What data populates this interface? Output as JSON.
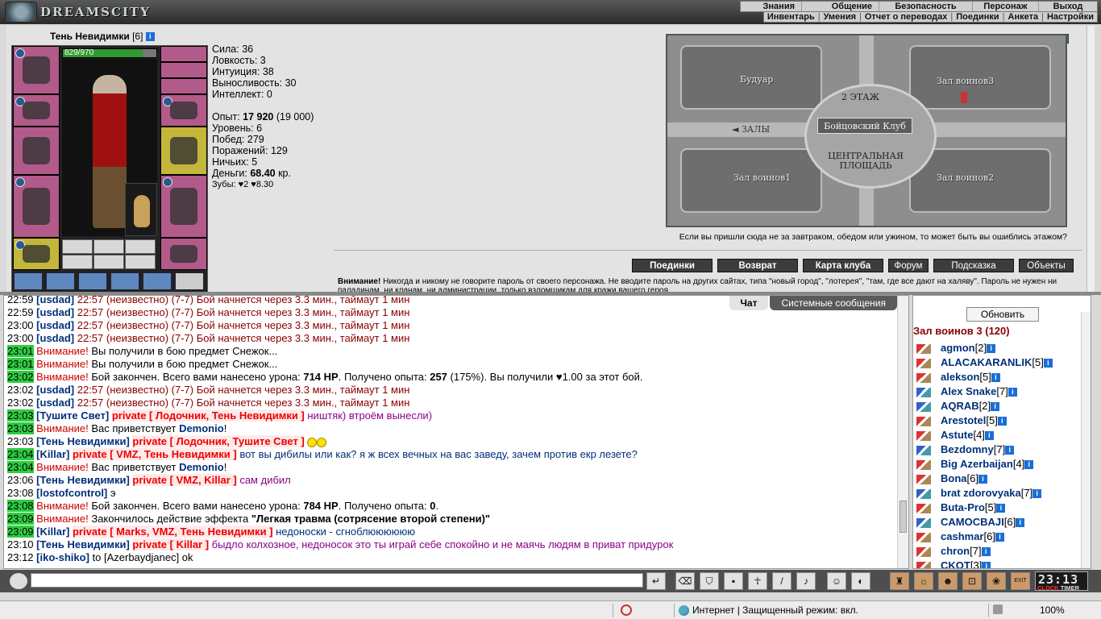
{
  "app": {
    "logo": "DREAMSCITY"
  },
  "menu_top": [
    "Знания",
    "Общение",
    "Безопасность",
    "Персонаж",
    "Выход"
  ],
  "menu_sub": [
    "Инвентарь",
    "Умения",
    "Отчет о переводах",
    "Поединки",
    "Анкета",
    "Настройки"
  ],
  "player": {
    "name": "Тень Невидимки",
    "level": "[6]",
    "hp": "829/970",
    "hp_fraction": 0.855
  },
  "stats": {
    "strength": "Сила: 36",
    "agility": "Ловкость: 3",
    "intuition": "Интуиция: 38",
    "endurance": "Выносливость: 30",
    "intellect": "Интеллект: 0",
    "exp_label": "Опыт: ",
    "exp_value": "17 920",
    "exp_next": " (19 000)",
    "level": "Уровень: 6",
    "wins": "Побед: 279",
    "losses": "Поражений: 129",
    "draws": "Ничьих: 5",
    "money_label": "Деньги: ",
    "money_value": "68.40",
    "money_unit": " кр.",
    "teeth": "Зубы: ♥2 ♥8.30"
  },
  "map": {
    "rooms": [
      "Будуар",
      "Зал воинов3",
      "Зал воинов1",
      "Зал воинов2"
    ],
    "floor": "2 ЭТАЖ",
    "club": "Бойцовский Клуб",
    "halls": "◄ ЗАЛЫ",
    "square": "ЦЕНТРАЛЬНАЯ ПЛОЩАДЬ",
    "note": "Если вы пришли сюда не за завтраком, обедом или ужином, то может быть вы ошиблись этажом?"
  },
  "buttons": [
    "Поединки",
    "Возврат",
    "Карта клуба",
    "Форум",
    "Подсказка",
    "Объекты"
  ],
  "warning": {
    "bold": "Внимание!",
    "text": " Никогда и никому не говорите пароль от своего персонажа. Не вводите пароль на других сайтах, типа \"новый город\", \"лотерея\", \"там, где все дают на халяву\". Пароль не нужен ни паладинам, ни кланам, ни администрации, только взломщикам для кражи вашего героя."
  },
  "chat_tabs": [
    "Чат",
    "Системные сообщения"
  ],
  "chat": [
    {
      "t": "22:59",
      "g": false,
      "parts": [
        [
          "n",
          "[usdad]"
        ],
        [
          "sys",
          " 22:57 (неизвестно) (7-7) Бой начнется через 3.3 мин., таймаут 1 мин"
        ]
      ]
    },
    {
      "t": "22:59",
      "g": false,
      "parts": [
        [
          "n",
          "[usdad]"
        ],
        [
          "sys",
          " 22:57 (неизвестно) (7-7) Бой начнется через 3.3 мин., таймаут 1 мин"
        ]
      ]
    },
    {
      "t": "23:00",
      "g": false,
      "parts": [
        [
          "n",
          "[usdad]"
        ],
        [
          "sys",
          " 22:57 (неизвестно) (7-7) Бой начнется через 3.3 мин., таймаут 1 мин"
        ]
      ]
    },
    {
      "t": "23:00",
      "g": false,
      "parts": [
        [
          "n",
          "[usdad]"
        ],
        [
          "sys",
          " 22:57 (неизвестно) (7-7) Бой начнется через 3.3 мин., таймаут 1 мин"
        ]
      ]
    },
    {
      "t": "23:01",
      "g": true,
      "parts": [
        [
          "warn",
          "Внимание!"
        ],
        [
          "x",
          " Вы получили в бою предмет Снежок..."
        ]
      ]
    },
    {
      "t": "23:01",
      "g": true,
      "parts": [
        [
          "warn",
          "Внимание!"
        ],
        [
          "x",
          " Вы получили в бою предмет Снежок..."
        ]
      ]
    },
    {
      "t": "23:02",
      "g": true,
      "parts": [
        [
          "warn",
          "Внимание!"
        ],
        [
          "x",
          " Бой закончен. Всего вами нанесено урона: "
        ],
        [
          "b",
          "714 HP"
        ],
        [
          "x",
          ". Получено опыта: "
        ],
        [
          "b",
          "257"
        ],
        [
          "x",
          " (175%). Вы получили ♥1.00 за этот бой."
        ]
      ]
    },
    {
      "t": "23:02",
      "g": false,
      "parts": [
        [
          "n",
          "[usdad]"
        ],
        [
          "sys",
          " 22:57 (неизвестно) (7-7) Бой начнется через 3.3 мин., таймаут 1 мин"
        ]
      ]
    },
    {
      "t": "23:02",
      "g": false,
      "parts": [
        [
          "n",
          "[usdad]"
        ],
        [
          "sys",
          " 22:57 (неизвестно) (7-7) Бой начнется через 3.3 мин., таймаут 1 мин"
        ]
      ]
    },
    {
      "t": "23:03",
      "g": true,
      "parts": [
        [
          "n",
          "[Тушите Свет]"
        ],
        [
          "x",
          " "
        ],
        [
          "priv",
          "private [ Лодочник, Тень Невидимки ]"
        ],
        [
          "purple",
          " ништяк) втроём вынесли)"
        ]
      ]
    },
    {
      "t": "23:03",
      "g": true,
      "parts": [
        [
          "warn",
          "Внимание!"
        ],
        [
          "x",
          " Вас приветствует "
        ],
        [
          "n",
          "Demonio"
        ],
        [
          "x",
          "!"
        ]
      ]
    },
    {
      "t": "23:03",
      "g": false,
      "parts": [
        [
          "n",
          "[Тень Невидимки]"
        ],
        [
          "x",
          " "
        ],
        [
          "priv",
          "private [ Лодочник, Тушите Свет ]"
        ],
        [
          "x",
          " "
        ],
        [
          "smile",
          ""
        ],
        [
          "smile",
          ""
        ]
      ]
    },
    {
      "t": "23:04",
      "g": true,
      "parts": [
        [
          "n",
          "[Killar]"
        ],
        [
          "x",
          " "
        ],
        [
          "priv",
          "private [ VMZ, Тень Невидимки ]"
        ],
        [
          "navy",
          " вот вы дибилы или как? я ж всех вечных на вас заведу, зачем против екр лезете?"
        ]
      ]
    },
    {
      "t": "23:04",
      "g": true,
      "parts": [
        [
          "warn",
          "Внимание!"
        ],
        [
          "x",
          " Вас приветствует "
        ],
        [
          "n",
          "Demonio"
        ],
        [
          "x",
          "!"
        ]
      ]
    },
    {
      "t": "23:06",
      "g": false,
      "parts": [
        [
          "n",
          "[Тень Невидимки]"
        ],
        [
          "x",
          " "
        ],
        [
          "priv",
          "private [ VMZ, Killar ]"
        ],
        [
          "purple",
          " сам дибил"
        ]
      ]
    },
    {
      "t": "23:08",
      "g": false,
      "parts": [
        [
          "n",
          "[lostofcontrol]"
        ],
        [
          "x",
          " э"
        ]
      ]
    },
    {
      "t": "23:08",
      "g": true,
      "parts": [
        [
          "warn",
          "Внимание!"
        ],
        [
          "x",
          " Бой закончен. Всего вами нанесено урона: "
        ],
        [
          "b",
          "784 HP"
        ],
        [
          "x",
          ". Получено опыта: "
        ],
        [
          "b",
          "0"
        ],
        [
          "x",
          "."
        ]
      ]
    },
    {
      "t": "23:09",
      "g": true,
      "parts": [
        [
          "warn",
          "Внимание!"
        ],
        [
          "x",
          " Закончилось действие эффекта "
        ],
        [
          "b",
          "\"Легкая травма (сотрясение второй степени)\""
        ]
      ]
    },
    {
      "t": "23:09",
      "g": true,
      "parts": [
        [
          "n",
          "[Killar]"
        ],
        [
          "x",
          " "
        ],
        [
          "priv",
          "private [ Marks, VMZ, Тень Невидимки ]"
        ],
        [
          "navy",
          " недоноски - сгноблюююююю"
        ]
      ]
    },
    {
      "t": "23:10",
      "g": false,
      "parts": [
        [
          "n",
          "[Тень Невидимки]"
        ],
        [
          "x",
          " "
        ],
        [
          "priv",
          "private [ Killar ]"
        ],
        [
          "purple",
          " быдло колхозное, недоносок это ты играй себе спокойно и не маячь людям в приват придурок"
        ]
      ]
    },
    {
      "t": "23:12",
      "g": false,
      "parts": [
        [
          "n",
          "[iko-shiko]"
        ],
        [
          "x",
          " to [Azerbaydjanec] ok"
        ]
      ]
    }
  ],
  "users_panel": {
    "refresh": "Обновить",
    "room": "Зал воинов 3 (120)",
    "users": [
      {
        "name": "agmon",
        "lvl": "[2]",
        "blue": false
      },
      {
        "name": "ALACAKARANLIK",
        "lvl": "[5]",
        "blue": false
      },
      {
        "name": "alekson",
        "lvl": "[5]",
        "blue": false
      },
      {
        "name": "Alex Snake",
        "lvl": "[7]",
        "blue": true
      },
      {
        "name": "AQRAB",
        "lvl": "[2]",
        "blue": true
      },
      {
        "name": "Arestotel",
        "lvl": "[5]",
        "blue": false
      },
      {
        "name": "Astute",
        "lvl": "[4]",
        "blue": false
      },
      {
        "name": "Bezdomny",
        "lvl": "[7]",
        "blue": true
      },
      {
        "name": "Big Azerbaijan",
        "lvl": "[4]",
        "blue": false
      },
      {
        "name": "Bona",
        "lvl": "[6]",
        "blue": false
      },
      {
        "name": "brat zdorovyaka",
        "lvl": "[7]",
        "blue": true
      },
      {
        "name": "Buta-Pro",
        "lvl": "[5]",
        "blue": false
      },
      {
        "name": "CAMOCBAJI",
        "lvl": "[6]",
        "blue": true
      },
      {
        "name": "cashmar",
        "lvl": "[6]",
        "blue": false
      },
      {
        "name": "chron",
        "lvl": "[7]",
        "blue": false
      },
      {
        "name": "CKOT",
        "lvl": "[3]",
        "blue": false
      }
    ]
  },
  "clock": {
    "time": "23:13",
    "clock_label": "CLOCK",
    "timer_label": "TIMER"
  },
  "statusbar": {
    "zone": "Интернет | Защищенный режим: вкл.",
    "zoom": "100%"
  }
}
